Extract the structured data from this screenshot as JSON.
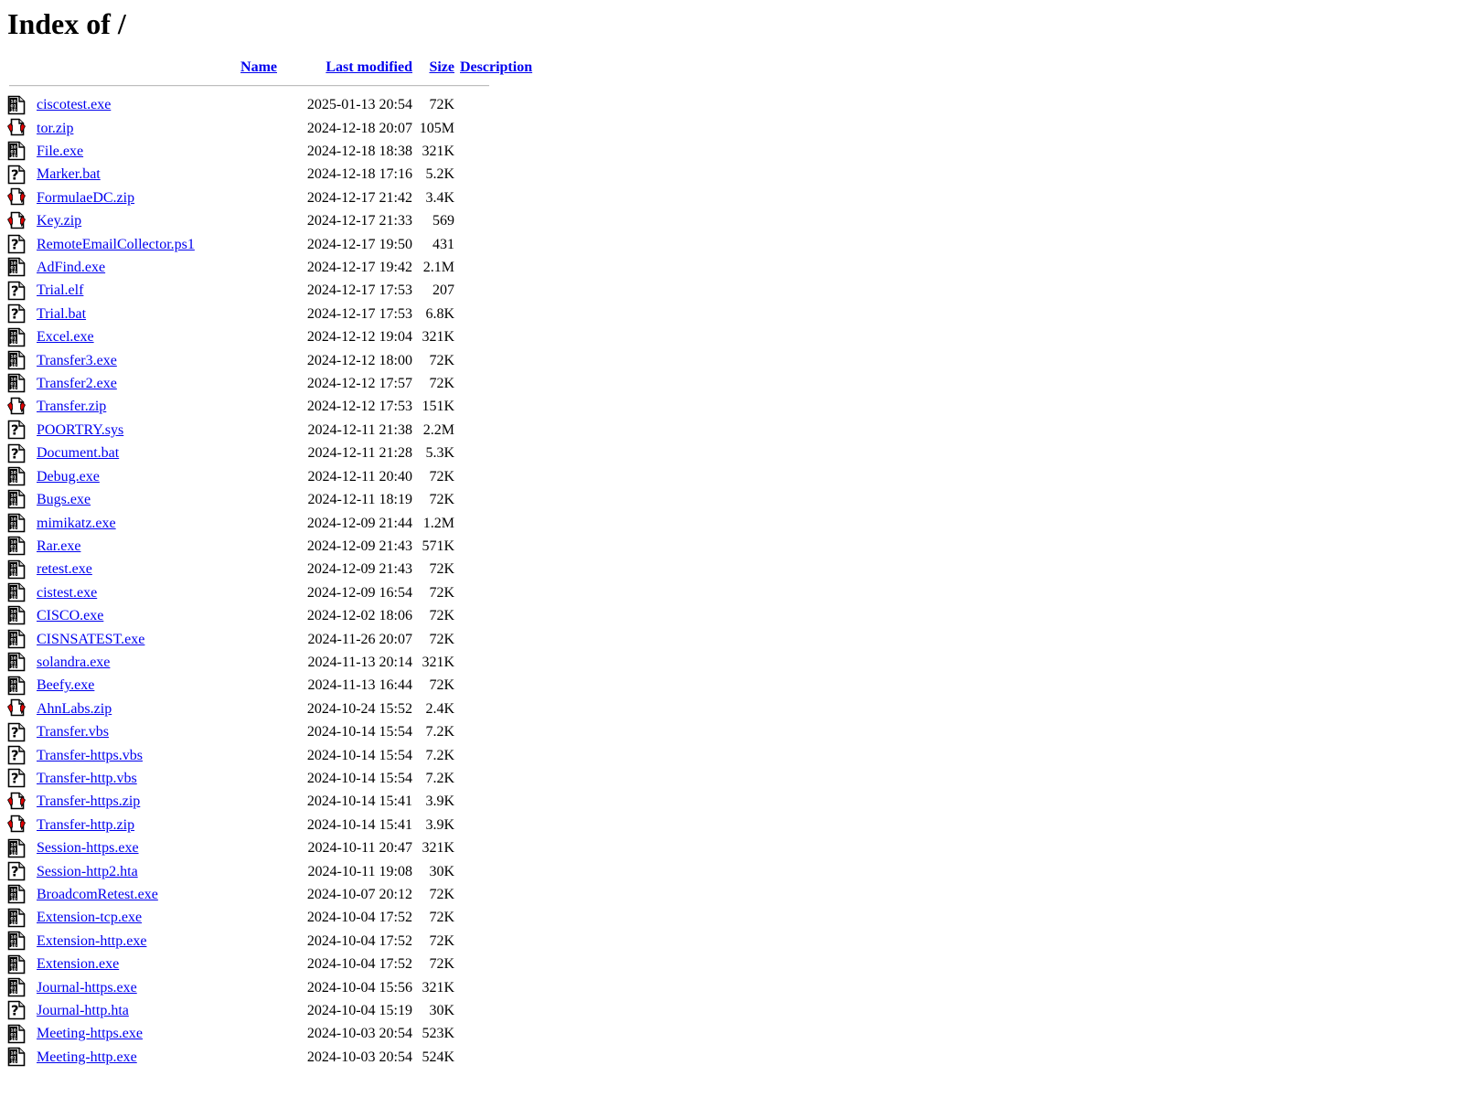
{
  "page": {
    "title": "Index of /"
  },
  "columns": {
    "name": "Name",
    "last_modified": "Last modified",
    "size": "Size",
    "description": "Description"
  },
  "colors": {
    "link": "#0000EE",
    "text": "#000000",
    "background": "#FFFFFF",
    "rule": "#BDBDBD",
    "icon_red": "#E00000",
    "icon_black": "#000000"
  },
  "icons": {
    "binary": "binary-file-icon",
    "compressed": "compressed-file-icon",
    "unknown": "unknown-file-icon"
  },
  "entries": [
    {
      "icon": "binary",
      "name": "ciscotest.exe",
      "last_modified": "2025-01-13 20:54",
      "size": "72K",
      "description": ""
    },
    {
      "icon": "compressed",
      "name": "tor.zip",
      "last_modified": "2024-12-18 20:07",
      "size": "105M",
      "description": ""
    },
    {
      "icon": "binary",
      "name": "File.exe",
      "last_modified": "2024-12-18 18:38",
      "size": "321K",
      "description": ""
    },
    {
      "icon": "unknown",
      "name": "Marker.bat",
      "last_modified": "2024-12-18 17:16",
      "size": "5.2K",
      "description": ""
    },
    {
      "icon": "compressed",
      "name": "FormulaeDC.zip",
      "last_modified": "2024-12-17 21:42",
      "size": "3.4K",
      "description": ""
    },
    {
      "icon": "compressed",
      "name": "Key.zip",
      "last_modified": "2024-12-17 21:33",
      "size": "569",
      "description": ""
    },
    {
      "icon": "unknown",
      "name": "RemoteEmailCollector.ps1",
      "last_modified": "2024-12-17 19:50",
      "size": "431",
      "description": ""
    },
    {
      "icon": "binary",
      "name": "AdFind.exe",
      "last_modified": "2024-12-17 19:42",
      "size": "2.1M",
      "description": ""
    },
    {
      "icon": "unknown",
      "name": "Trial.elf",
      "last_modified": "2024-12-17 17:53",
      "size": "207",
      "description": ""
    },
    {
      "icon": "unknown",
      "name": "Trial.bat",
      "last_modified": "2024-12-17 17:53",
      "size": "6.8K",
      "description": ""
    },
    {
      "icon": "binary",
      "name": "Excel.exe",
      "last_modified": "2024-12-12 19:04",
      "size": "321K",
      "description": ""
    },
    {
      "icon": "binary",
      "name": "Transfer3.exe",
      "last_modified": "2024-12-12 18:00",
      "size": "72K",
      "description": ""
    },
    {
      "icon": "binary",
      "name": "Transfer2.exe",
      "last_modified": "2024-12-12 17:57",
      "size": "72K",
      "description": ""
    },
    {
      "icon": "compressed",
      "name": "Transfer.zip",
      "last_modified": "2024-12-12 17:53",
      "size": "151K",
      "description": ""
    },
    {
      "icon": "unknown",
      "name": "POORTRY.sys",
      "last_modified": "2024-12-11 21:38",
      "size": "2.2M",
      "description": ""
    },
    {
      "icon": "unknown",
      "name": "Document.bat",
      "last_modified": "2024-12-11 21:28",
      "size": "5.3K",
      "description": ""
    },
    {
      "icon": "binary",
      "name": "Debug.exe",
      "last_modified": "2024-12-11 20:40",
      "size": "72K",
      "description": ""
    },
    {
      "icon": "binary",
      "name": "Bugs.exe",
      "last_modified": "2024-12-11 18:19",
      "size": "72K",
      "description": ""
    },
    {
      "icon": "binary",
      "name": "mimikatz.exe",
      "last_modified": "2024-12-09 21:44",
      "size": "1.2M",
      "description": ""
    },
    {
      "icon": "binary",
      "name": "Rar.exe",
      "last_modified": "2024-12-09 21:43",
      "size": "571K",
      "description": ""
    },
    {
      "icon": "binary",
      "name": "retest.exe",
      "last_modified": "2024-12-09 21:43",
      "size": "72K",
      "description": ""
    },
    {
      "icon": "binary",
      "name": "cistest.exe",
      "last_modified": "2024-12-09 16:54",
      "size": "72K",
      "description": ""
    },
    {
      "icon": "binary",
      "name": "CISCO.exe",
      "last_modified": "2024-12-02 18:06",
      "size": "72K",
      "description": ""
    },
    {
      "icon": "binary",
      "name": "CISNSATEST.exe",
      "last_modified": "2024-11-26 20:07",
      "size": "72K",
      "description": ""
    },
    {
      "icon": "binary",
      "name": "solandra.exe",
      "last_modified": "2024-11-13 20:14",
      "size": "321K",
      "description": ""
    },
    {
      "icon": "binary",
      "name": "Beefy.exe",
      "last_modified": "2024-11-13 16:44",
      "size": "72K",
      "description": ""
    },
    {
      "icon": "compressed",
      "name": "AhnLabs.zip",
      "last_modified": "2024-10-24 15:52",
      "size": "2.4K",
      "description": ""
    },
    {
      "icon": "unknown",
      "name": "Transfer.vbs",
      "last_modified": "2024-10-14 15:54",
      "size": "7.2K",
      "description": ""
    },
    {
      "icon": "unknown",
      "name": "Transfer-https.vbs",
      "last_modified": "2024-10-14 15:54",
      "size": "7.2K",
      "description": ""
    },
    {
      "icon": "unknown",
      "name": "Transfer-http.vbs",
      "last_modified": "2024-10-14 15:54",
      "size": "7.2K",
      "description": ""
    },
    {
      "icon": "compressed",
      "name": "Transfer-https.zip",
      "last_modified": "2024-10-14 15:41",
      "size": "3.9K",
      "description": ""
    },
    {
      "icon": "compressed",
      "name": "Transfer-http.zip",
      "last_modified": "2024-10-14 15:41",
      "size": "3.9K",
      "description": ""
    },
    {
      "icon": "binary",
      "name": "Session-https.exe",
      "last_modified": "2024-10-11 20:47",
      "size": "321K",
      "description": ""
    },
    {
      "icon": "unknown",
      "name": "Session-http2.hta",
      "last_modified": "2024-10-11 19:08",
      "size": "30K",
      "description": ""
    },
    {
      "icon": "binary",
      "name": "BroadcomRetest.exe",
      "last_modified": "2024-10-07 20:12",
      "size": "72K",
      "description": ""
    },
    {
      "icon": "binary",
      "name": "Extension-tcp.exe",
      "last_modified": "2024-10-04 17:52",
      "size": "72K",
      "description": ""
    },
    {
      "icon": "binary",
      "name": "Extension-http.exe",
      "last_modified": "2024-10-04 17:52",
      "size": "72K",
      "description": ""
    },
    {
      "icon": "binary",
      "name": "Extension.exe",
      "last_modified": "2024-10-04 17:52",
      "size": "72K",
      "description": ""
    },
    {
      "icon": "binary",
      "name": "Journal-https.exe",
      "last_modified": "2024-10-04 15:56",
      "size": "321K",
      "description": ""
    },
    {
      "icon": "unknown",
      "name": "Journal-http.hta",
      "last_modified": "2024-10-04 15:19",
      "size": "30K",
      "description": ""
    },
    {
      "icon": "binary",
      "name": "Meeting-https.exe",
      "last_modified": "2024-10-03 20:54",
      "size": "523K",
      "description": ""
    },
    {
      "icon": "binary",
      "name": "Meeting-http.exe",
      "last_modified": "2024-10-03 20:54",
      "size": "524K",
      "description": ""
    }
  ]
}
